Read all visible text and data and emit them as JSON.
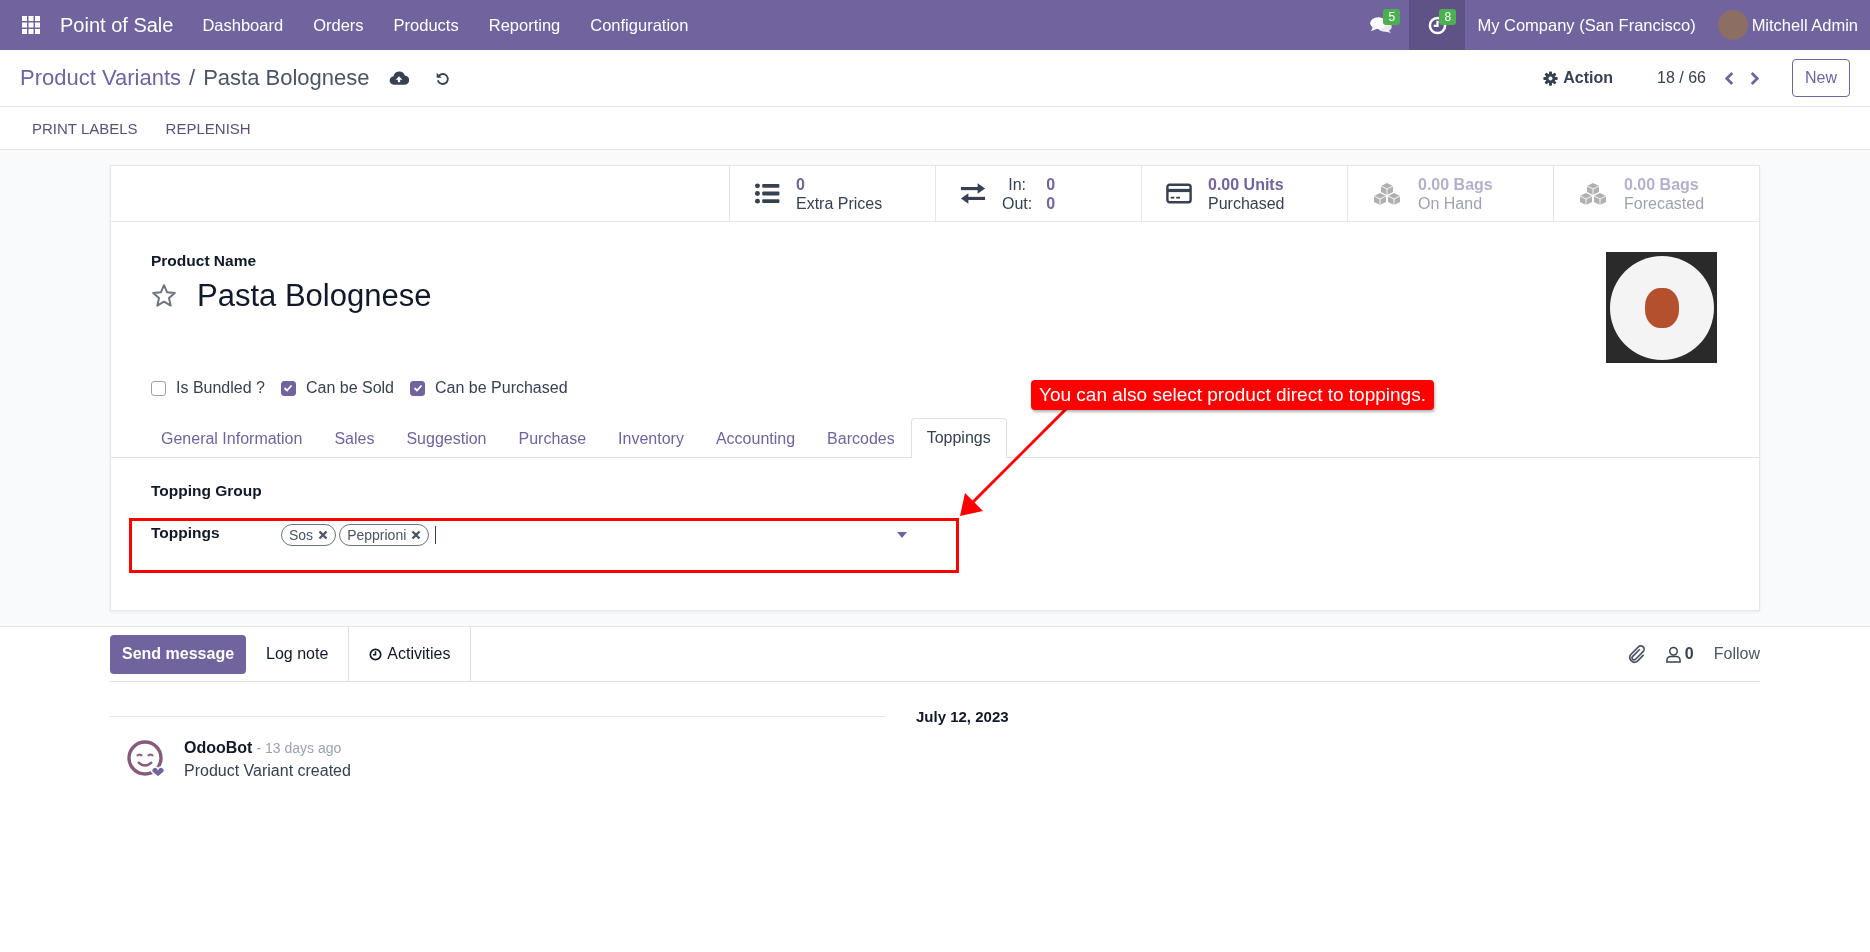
{
  "navbar": {
    "app_name": "Point of Sale",
    "menu": [
      "Dashboard",
      "Orders",
      "Products",
      "Reporting",
      "Configuration"
    ],
    "messages_count": "5",
    "activities_count": "8",
    "company": "My Company (San Francisco)",
    "user": "Mitchell Admin"
  },
  "control_panel": {
    "breadcrumb_parent": "Product Variants",
    "breadcrumb_separator": "/",
    "breadcrumb_current": "Pasta Bolognese",
    "action": "Action",
    "pager": "18 / 66",
    "new_button": "New",
    "header_buttons": [
      "PRINT LABELS",
      "REPLENISH"
    ]
  },
  "stat_buttons": [
    {
      "kind": "list",
      "value": "0",
      "label": "Extra Prices",
      "disabled": false
    },
    {
      "kind": "in-out",
      "rows": [
        {
          "label": "In:",
          "value": "0"
        },
        {
          "label": "Out:",
          "value": "0"
        }
      ],
      "disabled": false
    },
    {
      "kind": "card",
      "value": "0.00 Units",
      "label": "Purchased",
      "disabled": false
    },
    {
      "kind": "cubes",
      "value": "0.00 Bags",
      "label": "On Hand",
      "disabled": true
    },
    {
      "kind": "cubes",
      "value": "0.00 Bags",
      "label": "Forecasted",
      "disabled": true
    }
  ],
  "form": {
    "name_label": "Product Name",
    "name": "Pasta Bolognese",
    "favorite": false,
    "checkboxes": [
      {
        "label": "Is Bundled ?",
        "checked": false
      },
      {
        "label": "Can be Sold",
        "checked": true
      },
      {
        "label": "Can be Purchased",
        "checked": true
      }
    ],
    "tabs": [
      {
        "label": "General Information",
        "selected": false
      },
      {
        "label": "Sales",
        "selected": false
      },
      {
        "label": "Suggestion",
        "selected": false
      },
      {
        "label": "Purchase",
        "selected": false
      },
      {
        "label": "Inventory",
        "selected": false
      },
      {
        "label": "Accounting",
        "selected": false
      },
      {
        "label": "Barcodes",
        "selected": false
      },
      {
        "label": "Toppings",
        "selected": true
      }
    ],
    "fields": [
      {
        "kind": "empty",
        "label": "Topping Group"
      },
      {
        "kind": "tags",
        "label": "Toppings",
        "tags": [
          "Sos",
          "Pepprioni"
        ]
      }
    ]
  },
  "annotation": {
    "text": "You can also select product direct to toppings."
  },
  "chatter": {
    "send_message": "Send message",
    "log_note": "Log note",
    "activities": "Activities",
    "followers_count": "0",
    "follow": "Follow",
    "date": "July 12, 2023",
    "messages": [
      {
        "author": "OdooBot",
        "time": "- 13 days ago",
        "body": "Product Variant created"
      }
    ]
  }
}
